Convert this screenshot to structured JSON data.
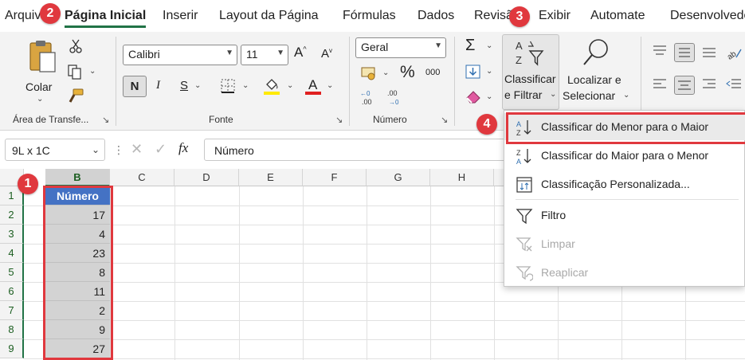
{
  "menubar": {
    "tabs": [
      "Arquivo",
      "Página Inicial",
      "Inserir",
      "Layout da Página",
      "Fórmulas",
      "Dados",
      "Revisão",
      "Exibir",
      "Automate",
      "Desenvolvedor"
    ],
    "active_tab": "Página Inicial"
  },
  "ribbon": {
    "clipboard": {
      "paste_label": "Colar",
      "group_label": "Área de Transfe..."
    },
    "font": {
      "font_name": "Calibri",
      "font_size": "11",
      "bold": "N",
      "italic": "I",
      "underline": "S",
      "group_label": "Fonte"
    },
    "number": {
      "format": "Geral",
      "percent": "%",
      "thousands": "000",
      "group_label": "Número"
    },
    "sort_filter": {
      "line1": "Classificar",
      "line2": "e Filtrar"
    },
    "find_select": {
      "line1": "Localizar e",
      "line2": "Selecionar"
    }
  },
  "formula_bar": {
    "name_box": "9L x 1C",
    "fx": "fx",
    "value": "Número"
  },
  "grid": {
    "columns": [
      "B",
      "C",
      "D",
      "E",
      "F",
      "G",
      "H"
    ],
    "rows": [
      "1",
      "2",
      "3",
      "4",
      "5",
      "6",
      "7",
      "8",
      "9"
    ],
    "column_b": [
      "Número",
      "17",
      "4",
      "23",
      "8",
      "11",
      "2",
      "9",
      "27"
    ]
  },
  "sort_menu": {
    "items": [
      {
        "label": "Classificar do Menor para o Maior",
        "enabled": true
      },
      {
        "label": "Classificar do Maior para o Menor",
        "enabled": true
      },
      {
        "label": "Classificação Personalizada...",
        "enabled": true
      },
      {
        "label": "Filtro",
        "enabled": true
      },
      {
        "label": "Limpar",
        "enabled": false
      },
      {
        "label": "Reaplicar",
        "enabled": false
      }
    ]
  },
  "badges": [
    "1",
    "2",
    "3",
    "4"
  ],
  "colors": {
    "accent_green": "#217346",
    "header_blue": "#4472c4",
    "highlight_red": "#e0383e"
  }
}
